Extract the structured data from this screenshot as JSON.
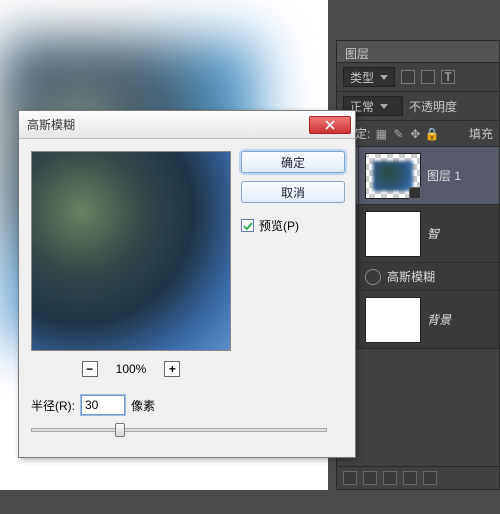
{
  "dialog": {
    "title": "高斯模糊",
    "ok": "确定",
    "cancel": "取消",
    "preview_label": "预览(P)",
    "preview_checked": true,
    "zoom": "100%",
    "radius_label": "半径(R):",
    "radius_value": "30",
    "radius_unit": "像素"
  },
  "layers_panel": {
    "tab": "图层",
    "filter_label": "类型",
    "blend_mode": "正常",
    "opacity_label": "不透明度",
    "lock_label": "锁定:",
    "fill_label": "填充",
    "layers": [
      {
        "name": "图层 1",
        "selected": true,
        "smart_object": true
      },
      {
        "name": "智",
        "italic": true
      },
      {
        "name": "高斯模糊"
      },
      {
        "name": "背景",
        "italic": true
      }
    ]
  }
}
